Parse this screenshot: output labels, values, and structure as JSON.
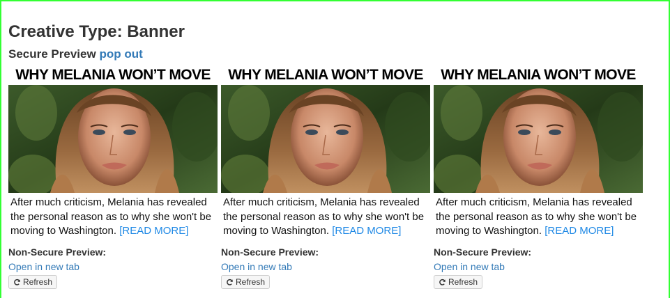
{
  "page": {
    "title": "Creative Type: Banner",
    "secure_label": "Secure Preview",
    "popout_label": "pop out",
    "frame_color": "#33ff33"
  },
  "ads": [
    {
      "headline": "WHY MELANIA WON’T MOVE",
      "body": "After much criticism, Melania has revealed the personal reason as to why she won't be moving to Washington.",
      "read_more": "[READ MORE]"
    },
    {
      "headline": "WHY MELANIA WON’T MOVE",
      "body": "After much criticism, Melania has revealed the personal reason as to why she won't be moving to Washington.",
      "read_more": "[READ MORE]"
    },
    {
      "headline": "WHY MELANIA WON’T MOVE",
      "body": "After much criticism, Melania has revealed the personal reason as to why she won't be moving to Washington.",
      "read_more": "[READ MORE]"
    }
  ],
  "previews": [
    {
      "label": "Non-Secure Preview:",
      "link": "Open in new tab",
      "refresh": "Refresh",
      "refresh_icon": "refresh-icon"
    },
    {
      "label": "Non-Secure Preview:",
      "link": "Open in new tab",
      "refresh": "Refresh",
      "refresh_icon": "refresh-icon"
    },
    {
      "label": "Non-Secure Preview:",
      "link": "Open in new tab",
      "refresh": "Refresh",
      "refresh_icon": "refresh-icon"
    }
  ],
  "colors": {
    "link": "#337ab7",
    "read_more": "#1e88e5",
    "text": "#333333"
  }
}
